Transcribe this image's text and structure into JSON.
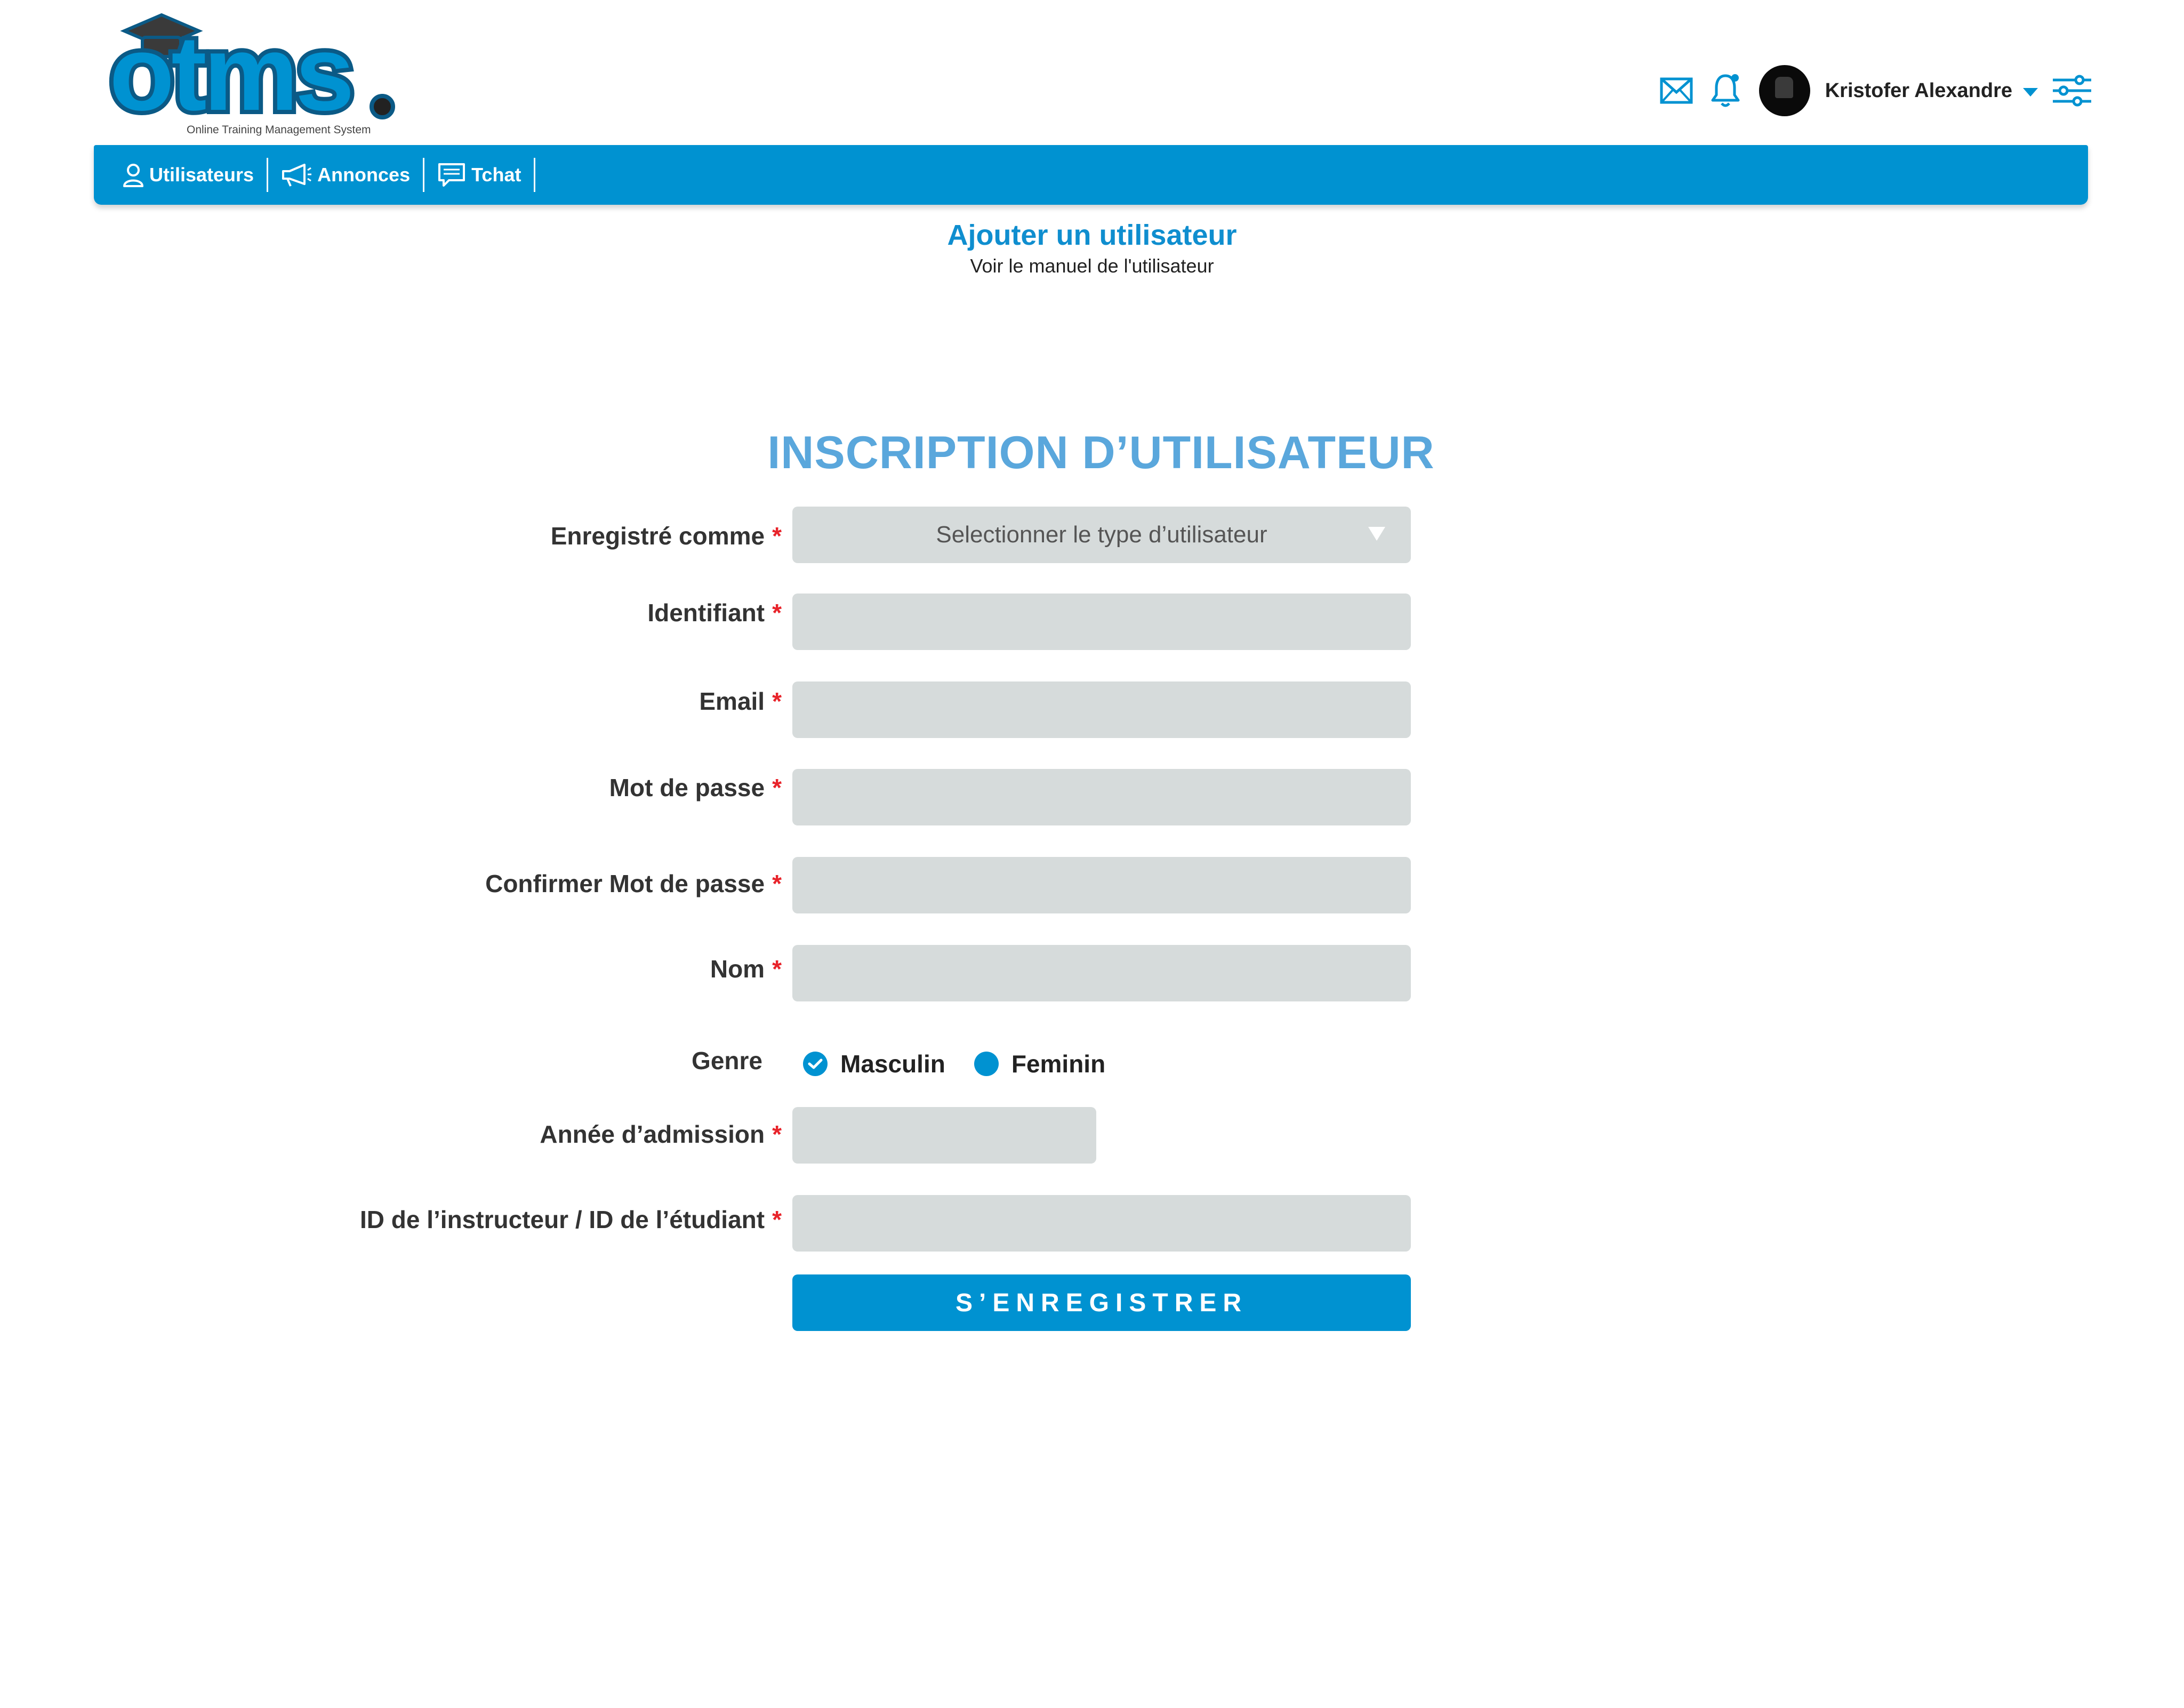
{
  "brand": {
    "logo_text": "otms",
    "tagline": "Online Training Management System"
  },
  "header": {
    "user_name": "Kristofer Alexandre",
    "icons": [
      "mail-icon",
      "bell-icon",
      "avatar",
      "chevron-down-icon",
      "settings-sliders-icon"
    ]
  },
  "nav": {
    "items": [
      {
        "label": "Utilisateurs",
        "icon": "user-icon"
      },
      {
        "label": "Annonces",
        "icon": "megaphone-icon"
      },
      {
        "label": "Tchat",
        "icon": "chat-icon"
      }
    ]
  },
  "page": {
    "title": "Ajouter un utilisateur",
    "subtitle": "Voir le manuel de l'utilisateur"
  },
  "form": {
    "title": "INSCRIPTION D’UTILISATEUR",
    "required_mark": "*",
    "register_as": {
      "label": "Enregistré comme",
      "placeholder": "Selectionner le type d’utilisateur"
    },
    "username": {
      "label": "Identifiant",
      "value": ""
    },
    "email": {
      "label": "Email",
      "value": ""
    },
    "password": {
      "label": "Mot de passe",
      "value": ""
    },
    "confirm_password": {
      "label": "Confirmer Mot de passe",
      "value": ""
    },
    "name": {
      "label": "Nom",
      "value": ""
    },
    "gender": {
      "label": "Genre",
      "options": [
        "Masculin",
        "Feminin"
      ],
      "selected": "Masculin"
    },
    "admission_year": {
      "label": "Année d’admission",
      "value": ""
    },
    "id_field": {
      "label": "ID de l’instructeur / ID de l’étudiant",
      "value": ""
    },
    "submit_label": "S’ENREGISTRER"
  },
  "colors": {
    "primary": "#0092d1",
    "title_blue": "#5aa7dc",
    "field_bg": "#d6dbdb",
    "required": "#e8232a"
  }
}
